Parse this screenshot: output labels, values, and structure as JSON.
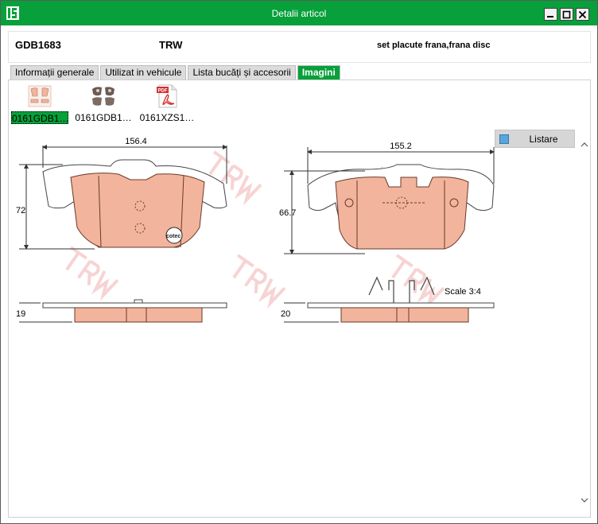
{
  "window": {
    "title": "Detalii articol",
    "controls": {
      "minimize": "minimize",
      "maximize": "maximize",
      "close": "close"
    }
  },
  "article": {
    "code": "GDB1683",
    "brand": "TRW",
    "description": "set placute frana,frana disc"
  },
  "tabs": [
    {
      "label": "Informații generale",
      "active": false
    },
    {
      "label": "Utilizat in vehicule",
      "active": false
    },
    {
      "label": "Lista bucăți și accesorii",
      "active": false
    },
    {
      "label": "Imagini",
      "active": true
    }
  ],
  "thumbnails": [
    {
      "label": "0161GDB1…",
      "icon": "brake-pad-drawing-icon",
      "selected": true
    },
    {
      "label": "0161GDB1…",
      "icon": "brake-pad-photo-icon",
      "selected": false
    },
    {
      "label": "0161XZS1…",
      "icon": "pdf-file-icon",
      "badge": "PDF",
      "selected": false
    }
  ],
  "drawing": {
    "left_width": "156.4",
    "left_height": "72",
    "left_thickness": "19",
    "right_width": "155.2",
    "right_height": "66.7",
    "right_thickness": "20",
    "scale": "Scale 3:4",
    "badge": "cotec",
    "watermark": "TRW",
    "colors": {
      "pad_fill": "#f2b49c",
      "pad_stroke": "#6a3a2a",
      "watermark": "#f6c0c0"
    }
  },
  "listare": {
    "label": "Listare",
    "icon": "list-icon"
  },
  "colors": {
    "accent": "#07a03a",
    "tab_inactive": "#dcdcdc"
  }
}
